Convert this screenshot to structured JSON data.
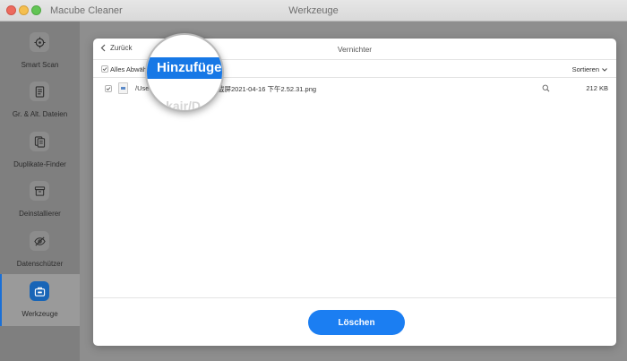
{
  "window": {
    "app_name": "Macube Cleaner",
    "title": "Werkzeuge"
  },
  "sidebar": {
    "items": [
      {
        "label": "Smart Scan",
        "icon": "target-icon"
      },
      {
        "label": "Gr. & Alt. Dateien",
        "icon": "document-icon"
      },
      {
        "label": "Duplikate-Finder",
        "icon": "duplicate-files-icon"
      },
      {
        "label": "Deinstallierer",
        "icon": "box-icon"
      },
      {
        "label": "Datenschützer",
        "icon": "eye-slash-icon"
      },
      {
        "label": "Werkzeuge",
        "icon": "toolbox-icon",
        "active": true
      }
    ]
  },
  "dialog": {
    "back_label": "Zurück",
    "title": "Vernichter",
    "select_all_label": "Alles Abwäh",
    "sort_label": "Sortieren",
    "file": {
      "path_start": "/Use",
      "path_end": "截屏2021-04-16 下午2.52.31.png",
      "size": "212 KB",
      "checked": true
    },
    "delete_label": "Löschen"
  },
  "magnifier": {
    "label": "Hinzufügen",
    "path_fragment": "ookair/D"
  },
  "colors": {
    "accent": "#1b7ef2",
    "active_sidebar_icon": "#1865b7"
  }
}
